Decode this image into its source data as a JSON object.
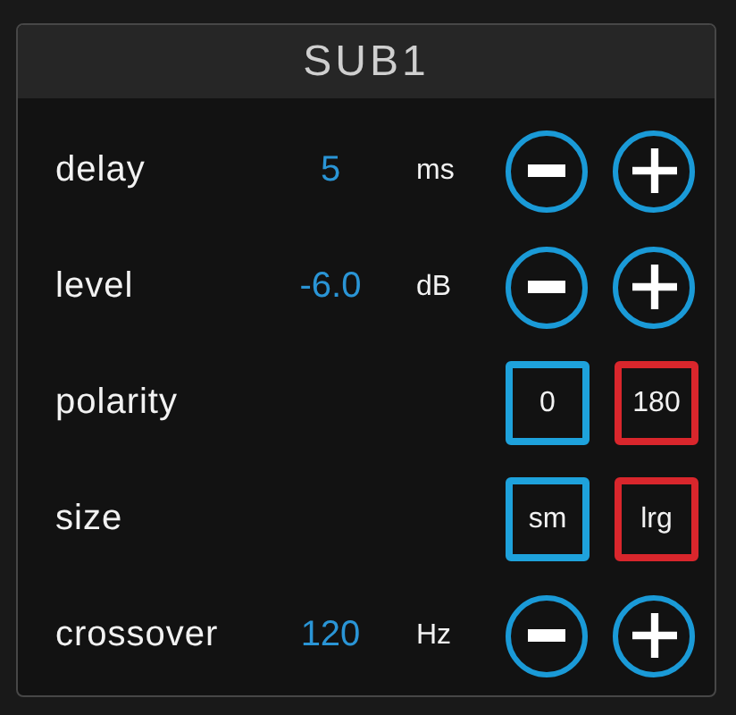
{
  "panel": {
    "title": "SUB1"
  },
  "rows": [
    {
      "kind": "stepper",
      "label": "delay",
      "value": "5",
      "unit": "ms"
    },
    {
      "kind": "stepper",
      "label": "level",
      "value": "-6.0",
      "unit": "dB"
    },
    {
      "kind": "toggle",
      "label": "polarity",
      "options": [
        {
          "label": "0",
          "color": "#1ea2dc"
        },
        {
          "label": "180",
          "color": "#d9262c"
        }
      ]
    },
    {
      "kind": "toggle",
      "label": "size",
      "options": [
        {
          "label": "sm",
          "color": "#1ea2dc"
        },
        {
          "label": "lrg",
          "color": "#d9262c"
        }
      ]
    },
    {
      "kind": "stepper",
      "label": "crossover",
      "value": "120",
      "unit": "Hz"
    }
  ]
}
